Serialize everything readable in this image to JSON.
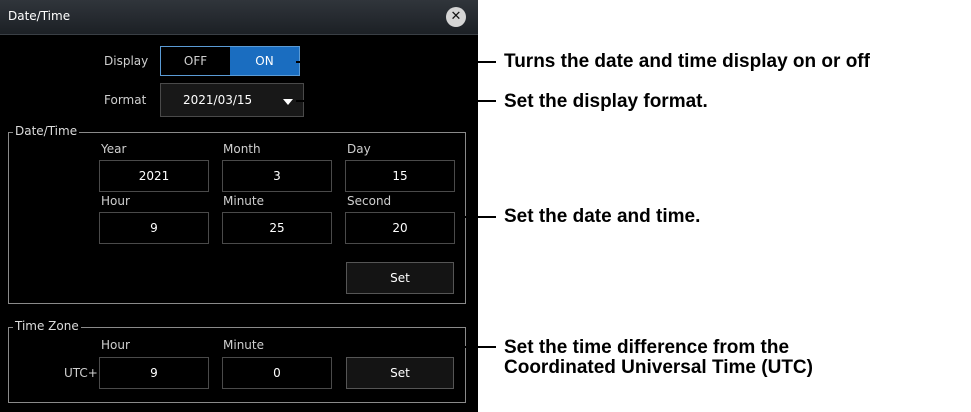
{
  "window": {
    "title": "Date/Time",
    "close_icon": "close-icon"
  },
  "display": {
    "label": "Display",
    "off": "OFF",
    "on": "ON",
    "selected": "ON",
    "accent": "#1a6dc0"
  },
  "format": {
    "label": "Format",
    "value": "2021/03/15"
  },
  "datetime_group": {
    "label": "Date/Time",
    "year_label": "Year",
    "year": "2021",
    "month_label": "Month",
    "month": "3",
    "day_label": "Day",
    "day": "15",
    "hour_label": "Hour",
    "hour": "9",
    "minute_label": "Minute",
    "minute": "25",
    "second_label": "Second",
    "second": "20",
    "set_label": "Set"
  },
  "timezone_group": {
    "label": "Time Zone",
    "hour_label": "Hour",
    "hour": "9",
    "minute_label": "Minute",
    "minute": "0",
    "utc_label": "UTC+",
    "set_label": "Set"
  },
  "annotations": {
    "display": "Turns the date and time display on or off",
    "format": "Set the display format.",
    "datetime": "Set the date and time.",
    "timezone_1": "Set the time difference from the",
    "timezone_2": "Coordinated Universal Time (UTC)"
  }
}
